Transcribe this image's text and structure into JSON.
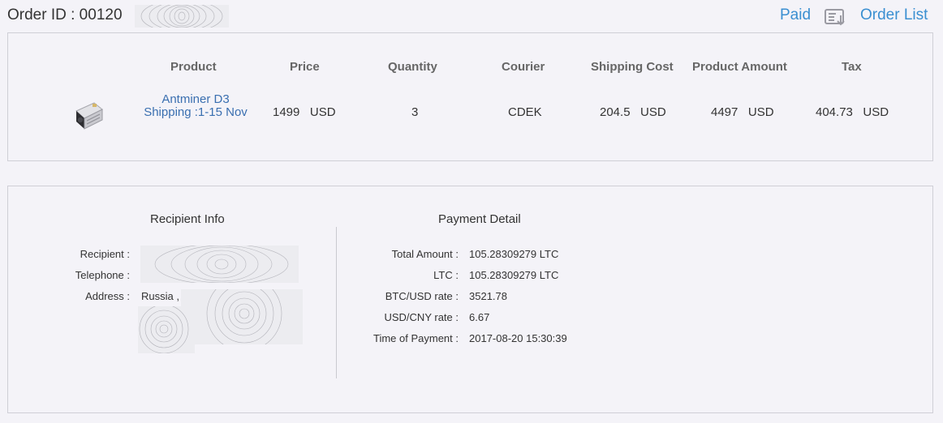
{
  "header": {
    "order_id_label": "Order ID : 00120",
    "status": "Paid",
    "order_list_label": "Order List",
    "order_list_icon": "order-list-icon"
  },
  "order_table": {
    "headers": {
      "product": "Product",
      "price": "Price",
      "quantity": "Quantity",
      "courier": "Courier",
      "shipping_cost": "Shipping Cost",
      "product_amount": "Product Amount",
      "tax": "Tax"
    },
    "row": {
      "product_name": "Antminer D3 Shipping :1-15 Nov",
      "price": "1499   USD",
      "quantity": "3",
      "courier": "CDEK",
      "shipping_cost": "204.5   USD",
      "product_amount": "4497   USD",
      "tax": "404.73   USD"
    }
  },
  "recipient_info": {
    "title": "Recipient Info",
    "recipient_label": "Recipient :",
    "telephone_label": "Telephone :",
    "address_label": "Address :",
    "address_value": "Russia ,"
  },
  "payment_detail": {
    "title": "Payment Detail",
    "total_amount_label": "Total Amount  :",
    "total_amount_value": "105.28309279 LTC",
    "ltc_label": "LTC  :",
    "ltc_value": "105.28309279 LTC",
    "btc_usd_label": "BTC/USD rate  :",
    "btc_usd_value": "3521.78",
    "usd_cny_label": "USD/CNY rate  :",
    "usd_cny_value": "6.67",
    "time_label": "Time of Payment  :",
    "time_value": "2017-08-20 15:30:39"
  },
  "colors": {
    "background": "#f4f3f8",
    "accent_blue": "#3a8fd1",
    "link_blue": "#3a6fb0",
    "border": "#cfcfd6"
  }
}
